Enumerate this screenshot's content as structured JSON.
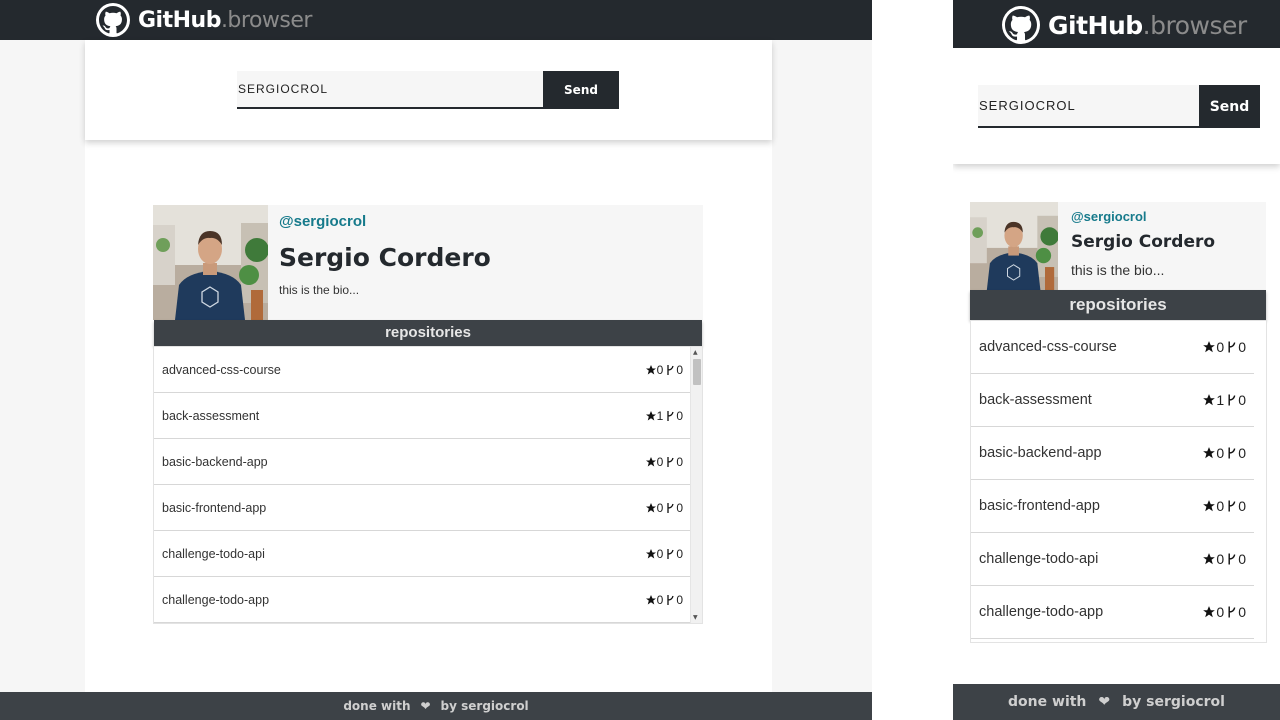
{
  "brand": {
    "name": "GitHub",
    "suffix": ".browser"
  },
  "search": {
    "value": "SERGIOCROL",
    "button_label": "Send"
  },
  "profile": {
    "username": "@sergiocrol",
    "full_name": "Sergio Cordero",
    "bio": "this is the bio..."
  },
  "repositories": {
    "heading": "repositories",
    "items": [
      {
        "name": "advanced-css-course",
        "stars": "0",
        "forks": "0"
      },
      {
        "name": "back-assessment",
        "stars": "1",
        "forks": "0"
      },
      {
        "name": "basic-backend-app",
        "stars": "0",
        "forks": "0"
      },
      {
        "name": "basic-frontend-app",
        "stars": "0",
        "forks": "0"
      },
      {
        "name": "challenge-todo-api",
        "stars": "0",
        "forks": "0"
      },
      {
        "name": "challenge-todo-app",
        "stars": "0",
        "forks": "0"
      }
    ]
  },
  "footer": {
    "prefix": "done with",
    "suffix": "by sergiocrol"
  },
  "icons": {
    "logo": "github-octocat-icon",
    "star": "star-icon",
    "fork": "fork-icon",
    "heart": "heart-icon"
  },
  "colors": {
    "header_bg": "#24292e",
    "accent": "#167a8b",
    "repo_bar_bg": "#3d4247"
  }
}
